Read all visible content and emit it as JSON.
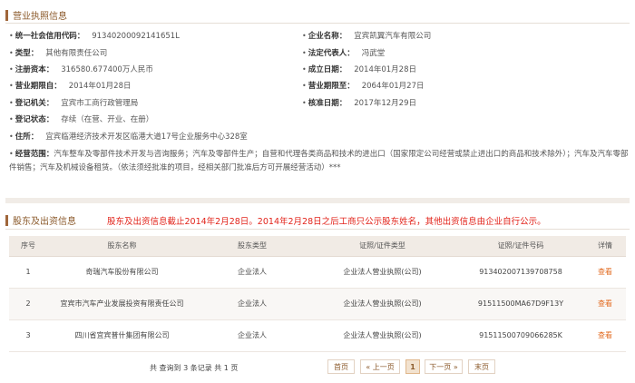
{
  "section1": {
    "title": "营业执照信息"
  },
  "info": {
    "credit_code": {
      "label": "统一社会信用代码：",
      "value": "91340200092141651L"
    },
    "company_name": {
      "label": "企业名称：",
      "value": "宜宾凯翼汽车有限公司"
    },
    "type": {
      "label": "类型：",
      "value": "其他有限责任公司"
    },
    "legal_rep": {
      "label": "法定代表人：",
      "value": "冯武堂"
    },
    "reg_capital": {
      "label": "注册资本：",
      "value": "316580.677400万人民币"
    },
    "founded": {
      "label": "成立日期：",
      "value": "2014年01月28日"
    },
    "term_from": {
      "label": "营业期限自：",
      "value": "2014年01月28日"
    },
    "term_to": {
      "label": "营业期限至：",
      "value": "2064年01月27日"
    },
    "reg_authority": {
      "label": "登记机关：",
      "value": "宜宾市工商行政管理局"
    },
    "approval_date": {
      "label": "核准日期：",
      "value": "2017年12月29日"
    },
    "reg_status": {
      "label": "登记状态：",
      "value": "存续（在营、开业、在册）"
    },
    "address": {
      "label": "住所：",
      "value": "宜宾临港经济技术开发区临港大道17号企业服务中心328室"
    },
    "scope": {
      "label": "经营范围：",
      "value": "汽车整车及零部件技术开发与咨询服务；汽车及零部件生产；自营和代理各类商品和技术的进出口（国家限定公司经营或禁止进出口的商品和技术除外）；汽车及汽车零部件销售；汽车及机械设备租赁。（依法须经批准的项目，经相关部门批准后方可开展经营活动）***"
    }
  },
  "section2": {
    "title": "股东及出资信息",
    "notice": "股东及出资信息截止2014年2月28日。2014年2月28日之后工商只公示股东姓名，其他出资信息由企业自行公示。"
  },
  "table": {
    "headers": [
      "序号",
      "股东名称",
      "股东类型",
      "证照/证件类型",
      "证照/证件号码",
      "详情"
    ],
    "rows": [
      {
        "no": "1",
        "name": "奇瑞汽车股份有限公司",
        "type": "企业法人",
        "cert_type": "企业法人营业执照(公司)",
        "cert_no": "913402007139708758",
        "detail": "查看"
      },
      {
        "no": "2",
        "name": "宜宾市汽车产业发展投资有限责任公司",
        "type": "企业法人",
        "cert_type": "企业法人营业执照(公司)",
        "cert_no": "91511500MA67D9F13Y",
        "detail": "查看"
      },
      {
        "no": "3",
        "name": "四川省宜宾普什集团有限公司",
        "type": "企业法人",
        "cert_type": "企业法人营业执照(公司)",
        "cert_no": "91511500709066285K",
        "detail": "查看"
      }
    ]
  },
  "pagination": {
    "summary": "共 查询到 3 条记录 共 1 页",
    "first": "首页",
    "prev": "« 上一页",
    "current": "1",
    "next": "下一页 »",
    "last": "末页"
  }
}
